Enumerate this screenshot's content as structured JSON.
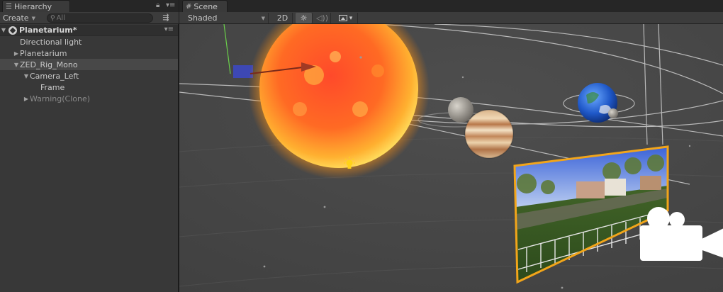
{
  "hierarchy": {
    "tab_title": "Hierarchy",
    "create_label": "Create",
    "search_placeholder": "All",
    "items": [
      {
        "label": "Planetarium*"
      },
      {
        "label": "Directional light"
      },
      {
        "label": "Planetarium"
      },
      {
        "label": "ZED_Rig_Mono"
      },
      {
        "label": "Camera_Left"
      },
      {
        "label": "Frame"
      },
      {
        "label": "Warning(Clone)"
      }
    ]
  },
  "scene": {
    "tab_title": "Scene",
    "shading_mode": "Shaded",
    "btn_2d": "2D"
  },
  "icons": {
    "hierarchy_tab": "list-icon",
    "scene_tab": "grid-icon",
    "lighting": "sun-icon",
    "audio": "speaker-icon",
    "effects": "image-icon",
    "camera_gizmo": "video-camera-icon",
    "light_gizmo": "light-bulb-icon"
  },
  "colors": {
    "selection_outline": "#f2a51a",
    "panel_bg": "#383838",
    "scene_bg": "#474747"
  }
}
